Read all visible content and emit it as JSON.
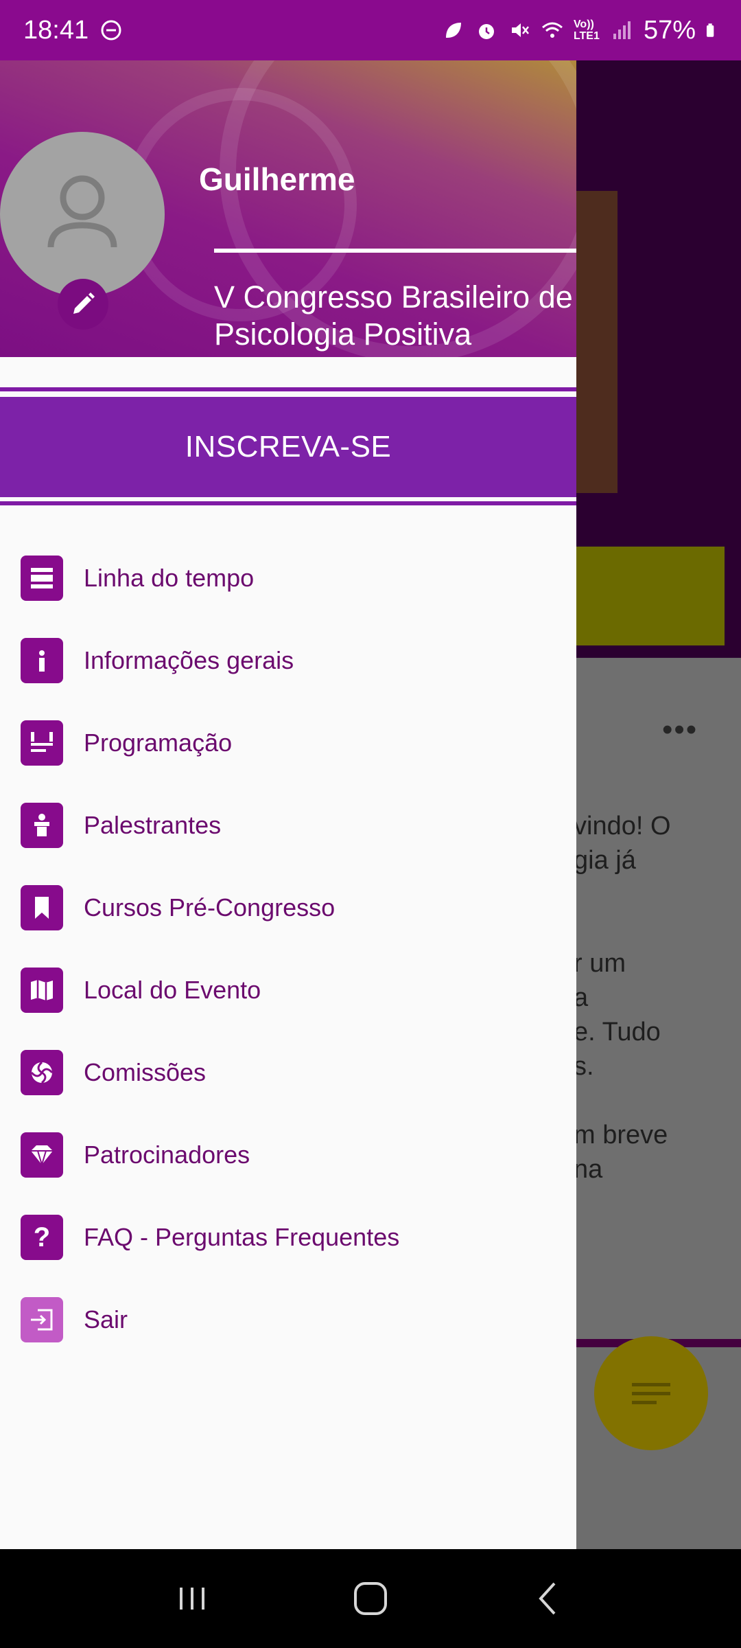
{
  "status_bar": {
    "time": "18:41",
    "battery": "57%",
    "network": "Vo)) LTE1",
    "icons": [
      "dnd-icon",
      "leaf-icon",
      "alarm-icon",
      "mute-icon",
      "wifi-icon",
      "signal-icon",
      "battery-icon"
    ]
  },
  "drawer": {
    "user_name": "Guilherme",
    "event_title": "V Congresso Brasileiro de Psicologia Positiva",
    "signup_label": "INSCREVA-SE",
    "menu": [
      {
        "label": "Linha do tempo",
        "icon": "timeline-icon"
      },
      {
        "label": "Informações gerais",
        "icon": "info-icon"
      },
      {
        "label": "Programação",
        "icon": "schedule-icon"
      },
      {
        "label": "Palestrantes",
        "icon": "speaker-icon"
      },
      {
        "label": "Cursos Pré-Congresso",
        "icon": "bookmark-icon"
      },
      {
        "label": "Local do Evento",
        "icon": "map-icon"
      },
      {
        "label": "Comissões",
        "icon": "committee-icon"
      },
      {
        "label": "Patrocinadores",
        "icon": "diamond-icon"
      },
      {
        "label": "FAQ - Perguntas Frequentes",
        "icon": "question-icon"
      },
      {
        "label": "Sair",
        "icon": "logout-icon"
      }
    ]
  },
  "background": {
    "text_lines_1": [
      "vindo! O",
      "gia já"
    ],
    "text_lines_2": [
      "r um",
      "a",
      "e. Tudo",
      "s."
    ],
    "text_lines_3": [
      "m breve",
      "na"
    ],
    "dots": "•••"
  },
  "colors": {
    "primary": "#870b8c",
    "status_bar": "#8a0a8e",
    "signup": "#7d22a8",
    "menu_text": "#6b0a6e"
  }
}
